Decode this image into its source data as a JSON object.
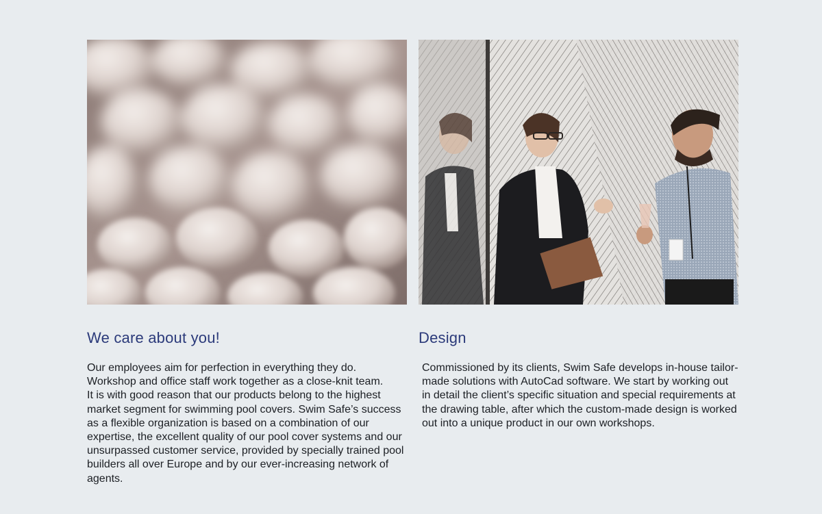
{
  "sections": [
    {
      "image": "blurred-white-foam-pellets-photo",
      "heading": "We care about you!",
      "paragraphs": [
        "Our employees aim for perfection in everything they do. Workshop and office staff work together as a close-knit team.",
        "It is with good reason that our products belong to the highest market segment for swimming pool covers. Swim Safe’s success as a flexible organization is based on a combination of our expertise, the excellent quality of our pool cover systems and our unsurpassed customer service, provided by specially trained pool builders all over Europe and by our ever-increasing network of agents."
      ]
    },
    {
      "image": "colleagues-laughing-photo",
      "heading": "Design",
      "paragraphs": [
        "Commissioned by its clients, Swim Safe develops in-house tailor-made solutions with AutoCad software. We start by working out in detail the client’s specific situation and special requirements at the drawing table, after which the custom-made design is worked out into a unique product in our own workshops."
      ]
    }
  ],
  "colors": {
    "background": "#e8ecef",
    "heading": "#2b3a7a",
    "body": "#1c1f24"
  }
}
